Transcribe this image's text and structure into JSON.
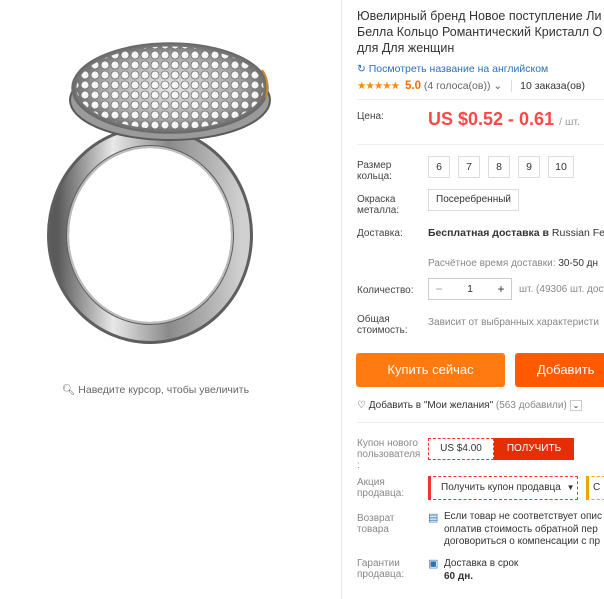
{
  "gallery": {
    "zoom_hint": "Наведите курсор, чтобы увеличить"
  },
  "product": {
    "title_lines": [
      "Ювелирный бренд Новое поступление Ли",
      "Белла Кольцо Романтический Кристалл О",
      "для Для женщин"
    ],
    "translate_link": "Посмотреть название на английском",
    "rating_value": "5.0",
    "votes": "(4 голоса(ов))",
    "orders": "10 заказа(ов)"
  },
  "price": {
    "label": "Цена:",
    "value": "US $0.52 - 0.61",
    "unit": "/ шт."
  },
  "ring_size": {
    "label": "Размер кольца:",
    "options": [
      "6",
      "7",
      "8",
      "9",
      "10"
    ]
  },
  "metal": {
    "label": "Окраска металла:",
    "option": "Посеребренный"
  },
  "shipping": {
    "label": "Доставка:",
    "text_bold": "Бесплатная доставка в",
    "text_rest": "Russian Fed",
    "time_label": "Расчётное время доставки:",
    "time_value": "30-50 дн"
  },
  "quantity": {
    "label": "Количество:",
    "value": "1",
    "minus": "−",
    "plus": "+",
    "stock": "шт. (49306 шт. досту"
  },
  "total": {
    "label": "Общая стоимость:",
    "note": "Зависит от выбранных характеристи"
  },
  "actions": {
    "buy_now": "Купить сейчас",
    "add_to_cart": "Добавить"
  },
  "wishlist": {
    "label": "Добавить в \"Мои желания\"",
    "count": "(563 добавили)"
  },
  "new_user_coupon": {
    "label": "Купон нового пользователя :",
    "amount": "US $4.00",
    "get": "ПОЛУЧИТЬ"
  },
  "seller_promo": {
    "label": "Акция продавца:",
    "button": "Получить купон продавца",
    "second": "С"
  },
  "returns": {
    "label": "Возврат товара",
    "lines": [
      "Если товар не соответствует опис",
      "оплатив стоимость обратной пер",
      "договориться о компенсации с пр"
    ]
  },
  "guarantee": {
    "label": "Гарантии продавца:",
    "line1": "Доставка в срок",
    "line2": "60 дн."
  },
  "colors": {
    "accent": "#ff7a10",
    "price": "#ff4747",
    "link": "#2d6fbe",
    "coupon_red": "#e62e04"
  }
}
